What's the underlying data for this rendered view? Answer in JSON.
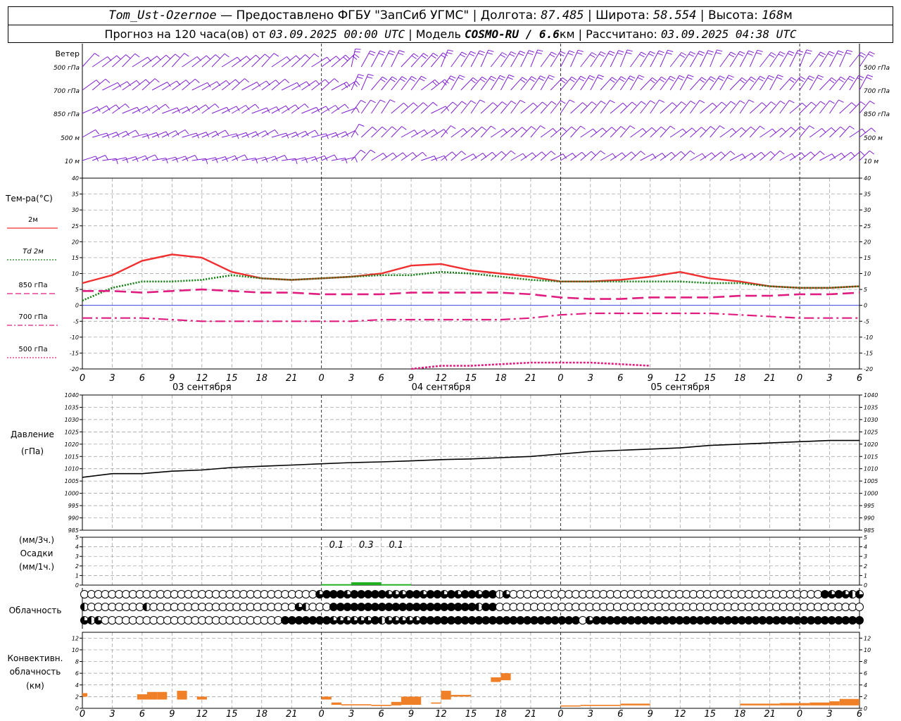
{
  "header": {
    "station": "Tom_Ust-Ozernoe",
    "provider": "— Предоставлено ФГБУ \"ЗапСиб УГМС\"",
    "lon_label": "Долгота:",
    "lon": "87.485",
    "lat_label": "Широта:",
    "lat": "58.554",
    "alt_label": "Высота:",
    "alt": "168",
    "alt_unit": "м",
    "forecast_label": "Прогноз на 120 часа(ов) от",
    "run_time": "03.09.2025 00:00 UTC",
    "model_label": "Модель",
    "model": "COSMO-RU / 6.6",
    "model_unit": "км",
    "computed_label": "Рассчитано:",
    "computed_time": "03.09.2025 04:38 UTC"
  },
  "wind": {
    "title": "Ветер",
    "levels": [
      "500 гПа",
      "700 гПа",
      "850 гПа",
      "500 м",
      "10  м"
    ]
  },
  "x_ticks": [
    "0",
    "3",
    "6",
    "9",
    "12",
    "15",
    "18",
    "21",
    "0",
    "3",
    "6",
    "9",
    "12",
    "15",
    "18",
    "21",
    "0",
    "3",
    "6",
    "9",
    "12",
    "15",
    "18",
    "21",
    "0",
    "3",
    "6"
  ],
  "day_labels": [
    "03 сентября",
    "04 сентября",
    "05 сентября"
  ],
  "temp_panel": {
    "title": "Тем-ра(°С)",
    "legend": [
      {
        "label": "2м",
        "color": "#f03030",
        "style": "solid"
      },
      {
        "label": "Td  2м",
        "color": "#108010",
        "style": "dotted"
      },
      {
        "label": "850 гПа",
        "color": "#e01c80",
        "style": "dashed"
      },
      {
        "label": "700 гПа",
        "color": "#e01c80",
        "style": "dashdot"
      },
      {
        "label": "500 гПа",
        "color": "#e01c80",
        "style": "dotted"
      }
    ],
    "yticks": [
      "40",
      "35",
      "30",
      "25",
      "20",
      "15",
      "10",
      "5",
      "0",
      "-5",
      "-10",
      "-15",
      "-20"
    ]
  },
  "pressure_panel": {
    "title": "Давление",
    "unit": "(гПа)",
    "yticks": [
      "1040",
      "1035",
      "1030",
      "1025",
      "1020",
      "1015",
      "1010",
      "1005",
      "1000",
      "995",
      "990",
      "985"
    ]
  },
  "precip_panel": {
    "unit1": "(мм/3ч.)",
    "title": "Осадки",
    "unit2": "(мм/1ч.)",
    "yticks": [
      "5",
      "4",
      "3",
      "2",
      "1",
      "0"
    ],
    "labels": [
      "0.1",
      "0.3",
      "0.1"
    ]
  },
  "cloud_panel": {
    "title": "Облачность"
  },
  "conv_panel": {
    "title1": "Конвективн.",
    "title2": "облачность",
    "unit": "(км)",
    "yticks": [
      "12",
      "10",
      "8",
      "6",
      "4",
      "2",
      "0"
    ]
  },
  "colors": {
    "t2m": "#f03030",
    "td": "#108010",
    "upper": "#e01c80",
    "wind": "#8020d0",
    "precip": "#20b020",
    "conv": "#f08028",
    "pressure": "#000000"
  },
  "chart_data": [
    {
      "type": "line",
      "title": "Тем-ра(°С)",
      "x_unit": "hours from 03.09.2025 00:00 UTC",
      "x": [
        0,
        3,
        6,
        9,
        12,
        15,
        18,
        21,
        24,
        27,
        30,
        33,
        36,
        39,
        42,
        45,
        48,
        51,
        54,
        57,
        60,
        63,
        66,
        69,
        72,
        75,
        78
      ],
      "ylim": [
        -20,
        40
      ],
      "series": [
        {
          "name": "2м",
          "values": [
            7,
            9.5,
            14,
            16,
            15,
            10.5,
            8.5,
            8,
            8.5,
            9,
            10,
            12.5,
            13,
            11,
            10,
            9,
            7.5,
            7.5,
            8,
            9,
            10.5,
            8.5,
            7.5,
            6,
            5.5,
            5.5,
            6
          ]
        },
        {
          "name": "Td  2м",
          "values": [
            1.5,
            5.5,
            7.5,
            7.5,
            8,
            9.5,
            8.5,
            8,
            8.5,
            9,
            9.5,
            9.5,
            10.5,
            10,
            9,
            8,
            7.5,
            7.5,
            7.5,
            7.5,
            7.5,
            7,
            7,
            6,
            5.5,
            5.5,
            6
          ]
        },
        {
          "name": "850 гПа",
          "values": [
            4.5,
            4.5,
            4,
            4.5,
            5,
            4.5,
            4,
            4,
            3.5,
            3.5,
            3.5,
            4,
            4,
            4,
            4,
            3.5,
            2.5,
            2,
            2,
            2.5,
            2.5,
            2.5,
            3,
            3,
            3.5,
            3.5,
            4
          ]
        },
        {
          "name": "700 гПа",
          "values": [
            -4,
            -4,
            -4,
            -4.5,
            -5,
            -5,
            -5,
            -5,
            -5,
            -5,
            -4.5,
            -4.5,
            -4.5,
            -4.5,
            -4.5,
            -4,
            -3,
            -2.5,
            -2.5,
            -2.5,
            -2.5,
            -2.5,
            -3,
            -3.5,
            -4,
            -4,
            -4
          ]
        },
        {
          "name": "500 гПа",
          "x": [
            33,
            36,
            39,
            42,
            45,
            48,
            51,
            54,
            57
          ],
          "values": [
            -20,
            -19,
            -19,
            -18.5,
            -18,
            -18,
            -18,
            -18.5,
            -19
          ]
        }
      ]
    },
    {
      "type": "line",
      "title": "Давление",
      "x_unit": "hours from 03.09.2025 00:00 UTC",
      "x": [
        0,
        3,
        6,
        9,
        12,
        15,
        18,
        21,
        24,
        27,
        30,
        33,
        36,
        39,
        42,
        45,
        48,
        51,
        54,
        57,
        60,
        63,
        66,
        69,
        72,
        75,
        78
      ],
      "ylim": [
        985,
        1040
      ],
      "series": [
        {
          "name": "Давление",
          "values": [
            1006.5,
            1008,
            1008,
            1009,
            1009.5,
            1010.5,
            1011,
            1011.5,
            1012,
            1012.5,
            1012.8,
            1013.2,
            1013.7,
            1014,
            1014.5,
            1015,
            1016,
            1017,
            1017.5,
            1018,
            1018.5,
            1019.5,
            1020,
            1020.5,
            1021,
            1021.5,
            1021.5
          ]
        }
      ]
    },
    {
      "type": "bar",
      "title": "Осадки",
      "x_unit": "hours from 03.09.2025 00:00 UTC",
      "ylim": [
        0,
        5
      ],
      "bars": [
        {
          "x0": 24,
          "x1": 27,
          "value": 0.1
        },
        {
          "x0": 27,
          "x1": 30,
          "value": 0.3
        },
        {
          "x0": 30,
          "x1": 33,
          "value": 0.1
        }
      ]
    },
    {
      "type": "bar",
      "title": "Конвективн. облачность",
      "x_unit": "hours from 03.09.2025 00:00 UTC",
      "ylim": [
        0,
        13
      ],
      "bars": [
        {
          "x0": 0,
          "x1": 0.5,
          "bottom": 2,
          "top": 2.6
        },
        {
          "x0": 5.5,
          "x1": 6.5,
          "bottom": 1.5,
          "top": 2.4
        },
        {
          "x0": 6.5,
          "x1": 7.5,
          "bottom": 1.5,
          "top": 2.8
        },
        {
          "x0": 7.5,
          "x1": 8.5,
          "bottom": 1.5,
          "top": 2.8
        },
        {
          "x0": 9.5,
          "x1": 10.5,
          "bottom": 1.5,
          "top": 3
        },
        {
          "x0": 11.5,
          "x1": 12.5,
          "bottom": 1.5,
          "top": 2
        },
        {
          "x0": 24,
          "x1": 25,
          "bottom": 1.5,
          "top": 2
        },
        {
          "x0": 25,
          "x1": 26,
          "bottom": 0.6,
          "top": 1
        },
        {
          "x0": 26,
          "x1": 29,
          "bottom": 0.5,
          "top": 0.7
        },
        {
          "x0": 29,
          "x1": 31,
          "bottom": 0.4,
          "top": 0.6
        },
        {
          "x0": 31,
          "x1": 32,
          "bottom": 0.5,
          "top": 1.1
        },
        {
          "x0": 32,
          "x1": 34,
          "bottom": 0.6,
          "top": 2
        },
        {
          "x0": 35,
          "x1": 36,
          "bottom": 0.8,
          "top": 1
        },
        {
          "x0": 36,
          "x1": 37,
          "bottom": 1.5,
          "top": 3
        },
        {
          "x0": 37,
          "x1": 39,
          "bottom": 2,
          "top": 2.3
        },
        {
          "x0": 41,
          "x1": 42,
          "bottom": 4.5,
          "top": 5.3
        },
        {
          "x0": 42,
          "x1": 43,
          "bottom": 4.8,
          "top": 6
        },
        {
          "x0": 48,
          "x1": 50,
          "bottom": 0.3,
          "top": 0.5
        },
        {
          "x0": 50,
          "x1": 54,
          "bottom": 0.4,
          "top": 0.6
        },
        {
          "x0": 54,
          "x1": 57,
          "bottom": 0.5,
          "top": 0.8
        },
        {
          "x0": 66,
          "x1": 70,
          "bottom": 0.5,
          "top": 0.8
        },
        {
          "x0": 70,
          "x1": 73,
          "bottom": 0.5,
          "top": 0.9
        },
        {
          "x0": 73,
          "x1": 75,
          "bottom": 0.5,
          "top": 1
        },
        {
          "x0": 75,
          "x1": 76,
          "bottom": 0.5,
          "top": 1.2
        },
        {
          "x0": 76,
          "x1": 78,
          "bottom": 0.5,
          "top": 1.6
        }
      ]
    }
  ],
  "clouds": {
    "upper": "00000000000000000000000000000000003444344444333443443434434413000000000000000000000000000000000000000000000434323",
    "middle": "20000000020000000000000000000003200044444444444444444444424400000000000000000000000000000000000000000000000000000",
    "lower": "32300000000000000000000000000444444433333342333334444444444444444444444403444444444444444444444444444444444444444"
  }
}
